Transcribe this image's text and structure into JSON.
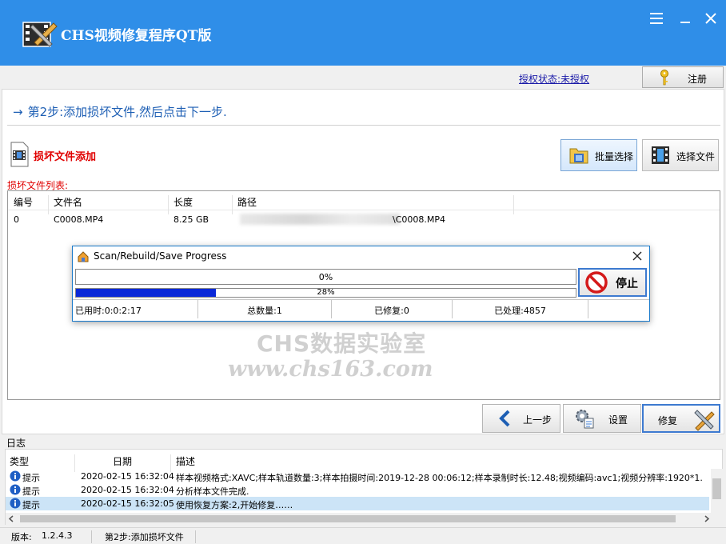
{
  "window": {
    "title": "CHS视频修复程序QT版",
    "colors": {
      "titlebar": "#2f8ee8",
      "accent": "#1e5fb4",
      "alert": "#e00000",
      "progress": "#0a28d8"
    }
  },
  "license": {
    "status_link": "授权状态:未授权",
    "register_label": "注册"
  },
  "step": {
    "arrow": "→",
    "text": "第2步:添加损坏文件,然后点击下一步."
  },
  "add_section": {
    "label": "损坏文件添加",
    "batch_select": "批量选择",
    "select_file": "选择文件",
    "list_caption": "损坏文件列表:"
  },
  "file_table": {
    "columns": [
      "编号",
      "文件名",
      "长度",
      "路径"
    ],
    "rows": [
      {
        "id": "0",
        "name": "C0008.MP4",
        "size": "8.25 GB",
        "path": "\\C0008.MP4"
      }
    ]
  },
  "watermark": {
    "line1": "CHS数据实验室",
    "line2": "www.chs163.com"
  },
  "progress_dialog": {
    "title": "Scan/Rebuild/Save Progress",
    "overall_label": "0%",
    "overall_value": 0,
    "current_label": "28%",
    "current_value": 0.28,
    "stop_label": "停止",
    "stats": {
      "elapsed": "已用时:0:0:2:17",
      "total": "总数量:1",
      "repaired": "已修复:0",
      "processed": "已处理:4857"
    }
  },
  "actions": {
    "prev": "上一步",
    "settings": "设置",
    "repair": "修复"
  },
  "log": {
    "caption": "日志",
    "columns": [
      "类型",
      "日期",
      "描述"
    ],
    "rows": [
      {
        "type": "提示",
        "date": "2020-02-15 16:32:04",
        "desc": "样本视频格式:XAVC;样本轨道数量:3;样本拍摄时间:2019-12-28 00:06:12;样本录制时长:12.48;视频编码:avc1;视频分辨率:1920*1."
      },
      {
        "type": "提示",
        "date": "2020-02-15 16:32:04",
        "desc": "分析样本文件完成."
      },
      {
        "type": "提示",
        "date": "2020-02-15 16:32:05",
        "desc": "使用恢复方案:2,开始修复……"
      }
    ]
  },
  "statusbar": {
    "version_label": "版本:",
    "version": "1.2.4.3",
    "step": "第2步:添加损坏文件"
  }
}
